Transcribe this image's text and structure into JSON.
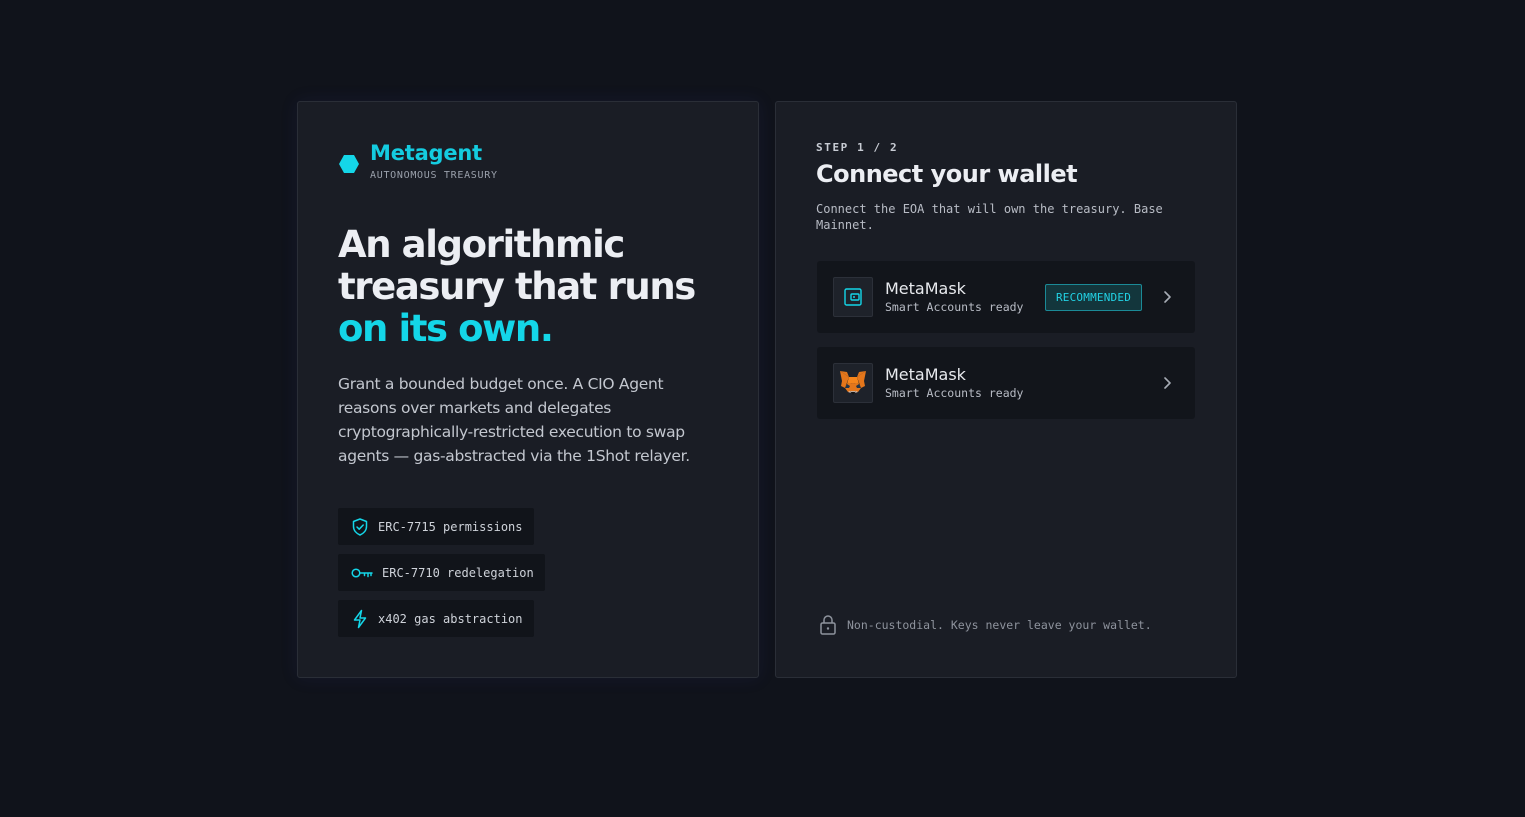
{
  "brand": {
    "name": "Metagent",
    "tagline": "AUTONOMOUS TREASURY",
    "accent_color": "#14d6e8"
  },
  "hero": {
    "line1": "An algorithmic",
    "line2": "treasury that runs",
    "line3_accent": "on its own.",
    "description": "Grant a bounded budget once. A CIO Agent reasons over markets and delegates cryptographically-restricted execution to swap agents — gas-abstracted via the 1Shot relayer."
  },
  "features": [
    {
      "icon": "shield-check-icon",
      "label": "ERC-7715 permissions"
    },
    {
      "icon": "key-icon",
      "label": "ERC-7710 redelegation"
    },
    {
      "icon": "lightning-icon",
      "label": "x402 gas abstraction"
    }
  ],
  "connect": {
    "step": "STEP 1 / 2",
    "title": "Connect your wallet",
    "subtitle": "Connect the EOA that will own the treasury. Base Mainnet.",
    "wallets": [
      {
        "icon": "wallet-icon",
        "name": "MetaMask",
        "sub": "Smart Accounts ready",
        "badge": "RECOMMENDED"
      },
      {
        "icon": "metamask-fox-icon",
        "name": "MetaMask",
        "sub": "Smart Accounts ready",
        "badge": ""
      }
    ],
    "footer": "Non-custodial. Keys never leave your wallet."
  }
}
